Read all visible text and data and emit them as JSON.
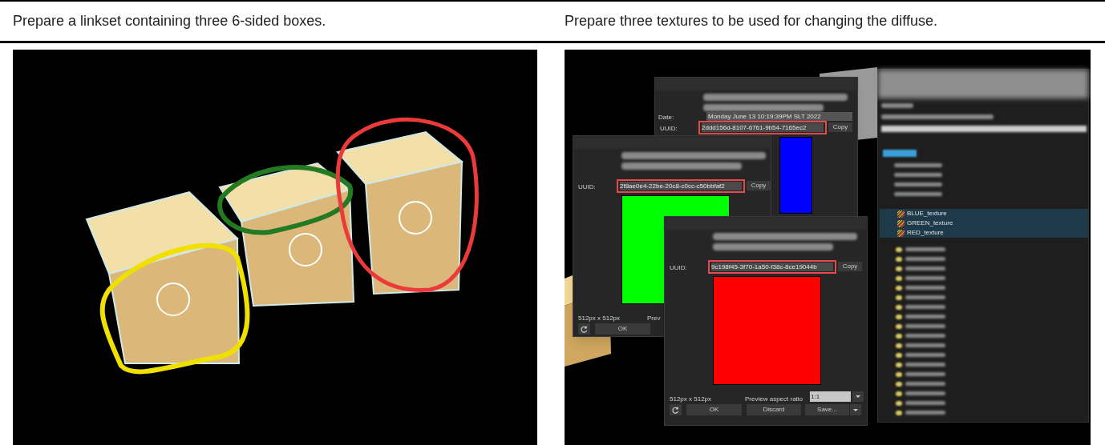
{
  "columns": [
    {
      "heading": "Prepare a linkset containing three 6-sided boxes."
    },
    {
      "heading": "Prepare three textures to be used for changing the diffuse.",
      "image": {
        "kind": "screenshot",
        "texture_windows": [
          {
            "color": "#0000ff",
            "date_label": "Date:",
            "date": "Monday June 13 10:19:39PM SLT 2022",
            "uuid_label": "UUID:",
            "uuid": "2ddd156d-8107-6761-9b54-7165ec2",
            "copy": "Copy"
          },
          {
            "color": "#00ff00",
            "uuid_label": "UUID:",
            "uuid": "2f8ae0e4-22be-20c8-c0cc-c50bbfaf2",
            "copy": "Copy",
            "size": "512px x 512px",
            "aspect_label": "Prev",
            "ok": "OK"
          },
          {
            "color": "#ff0000",
            "uuid_label": "UUID:",
            "uuid": "9c198f45-3f70-1a50-f38c-8ce19044b",
            "copy": "Copy",
            "size": "512px x 512px",
            "aspect_label": "Preview aspect ratio",
            "aspect": "1:1",
            "ok": "OK",
            "discard": "Discard",
            "save": "Save..."
          }
        ],
        "inventory": {
          "items": [
            {
              "label": "BLUE_texture",
              "selected": true
            },
            {
              "label": "GREEN_texture",
              "selected": true
            },
            {
              "label": "RED_texture",
              "selected": true
            }
          ]
        }
      }
    }
  ]
}
